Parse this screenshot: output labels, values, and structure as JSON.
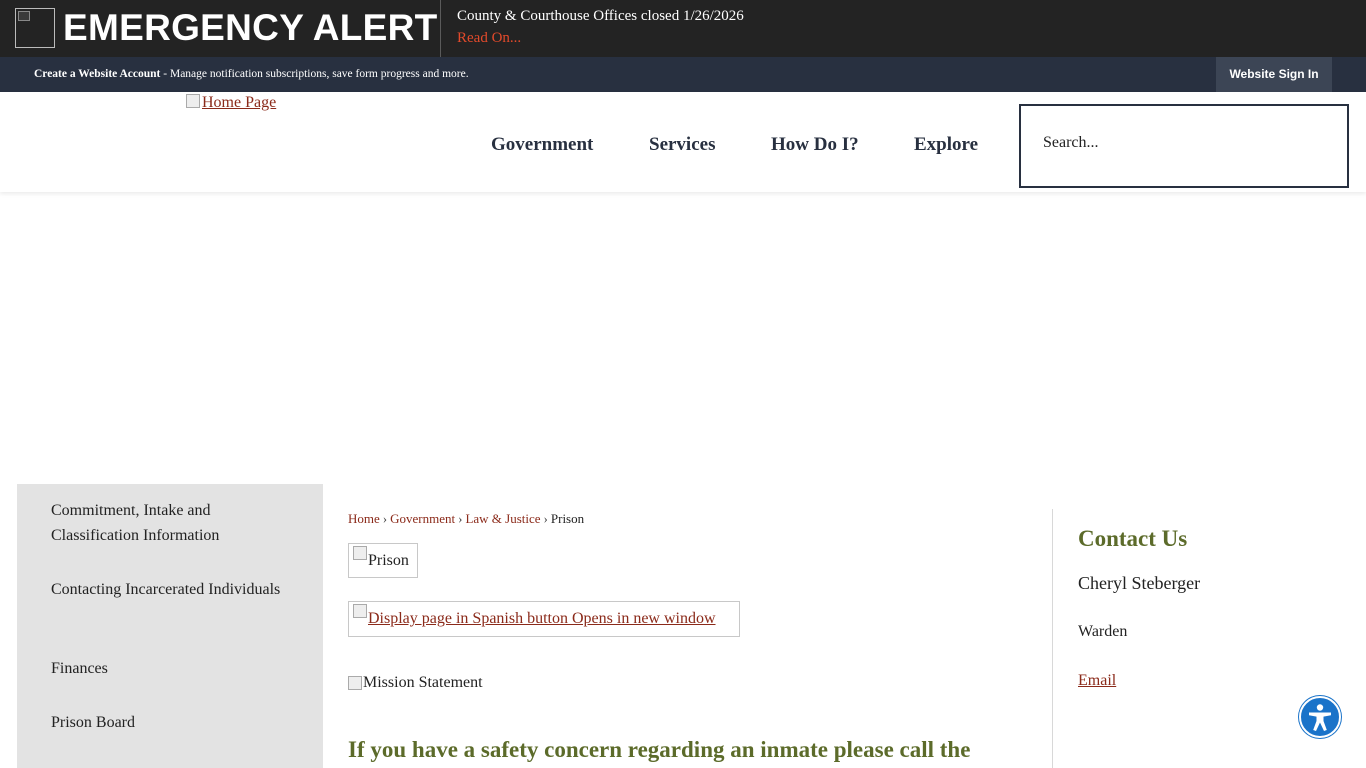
{
  "alert": {
    "title": "EMERGENCY ALERT",
    "message": "County & Courthouse Offices closed 1/26/2026",
    "link_label": "Read On...",
    "icon": "broken-image-icon"
  },
  "account_bar": {
    "create_account_label": "Create a Website Account",
    "description": " - Manage notification subscriptions, save form progress and more.",
    "sign_in_label": "Website Sign In"
  },
  "header": {
    "home_logo_alt": "Home Page",
    "nav": [
      "Government",
      "Services",
      "How Do I?",
      "Explore"
    ],
    "search_placeholder": "Search..."
  },
  "sidebar": {
    "items": [
      "Commitment, Intake and Classification Information",
      "Contacting Incarcerated Individuals",
      "Finances",
      "Prison Board"
    ]
  },
  "breadcrumb": {
    "items": [
      "Home",
      "Government",
      "Law & Justice"
    ],
    "current": "Prison"
  },
  "main": {
    "prison_image_alt": "Prison",
    "spanish_button_alt": "Display page in Spanish button Opens in new window",
    "mission_image_alt": "Mission Statement",
    "safety_heading": "If you have a safety concern regarding an inmate please call the"
  },
  "contact": {
    "title": "Contact Us",
    "name": "Cheryl Steberger",
    "role": "Warden",
    "email_label": "Email"
  },
  "colors": {
    "alert_bg": "#232323",
    "account_bar_bg": "#283040",
    "link": "#8b2a1a",
    "heading_green": "#5c6b2a",
    "sidebar_bg": "#e3e3e3",
    "accessibility_blue": "#1a73c9"
  },
  "accessibility": {
    "icon": "accessibility-icon"
  }
}
